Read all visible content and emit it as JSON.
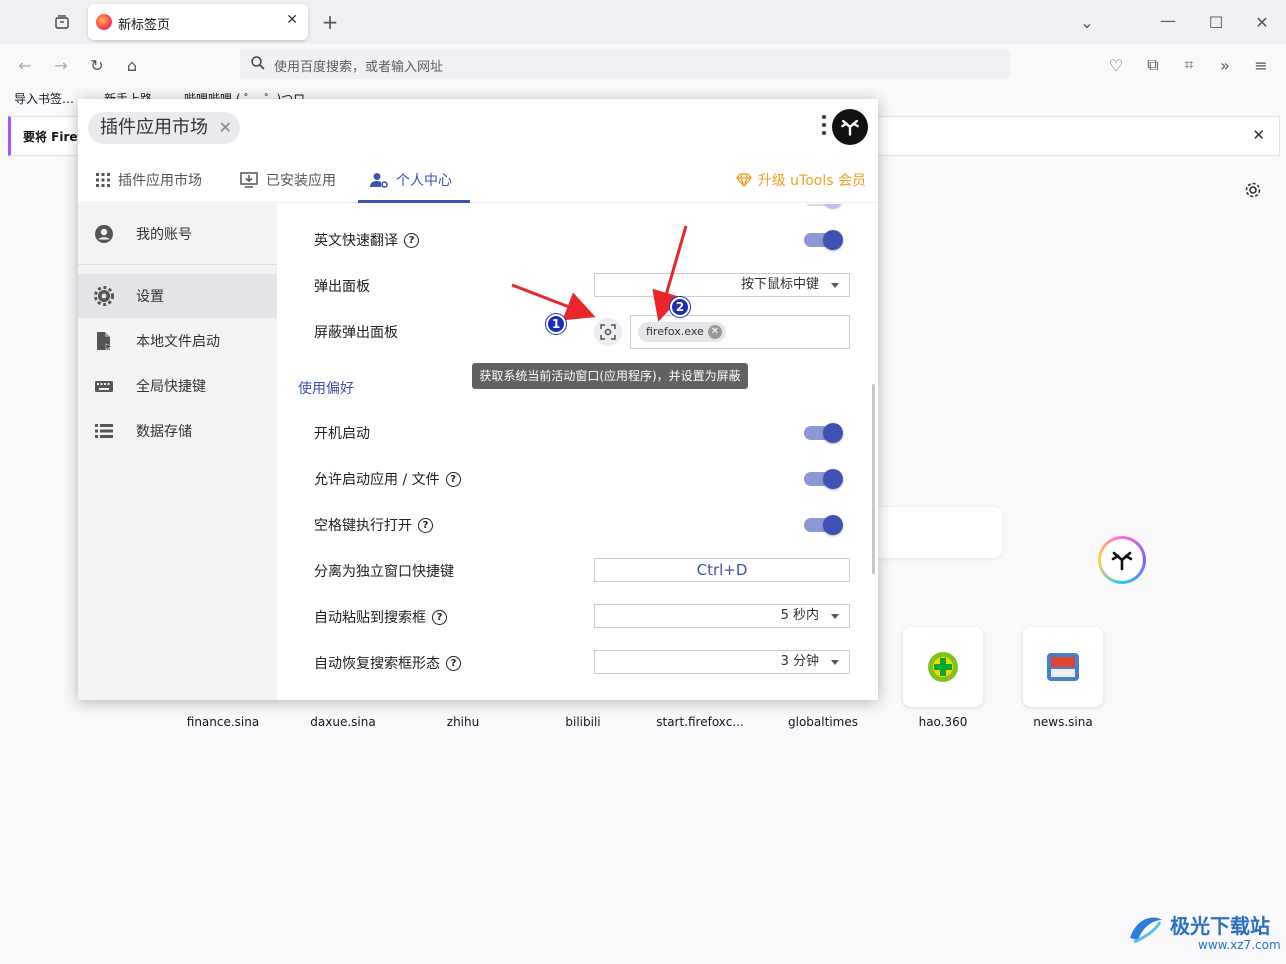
{
  "browser": {
    "tab_title": "新标签页",
    "url_placeholder": "使用百度搜索，或者输入网址",
    "bookmarks": [
      "导入书签…",
      "新手上路",
      "哔哩哔哩 ( ゜- ゜)つロ"
    ],
    "notification": "要将 Firef"
  },
  "panel": {
    "header_chip": "插件应用市场",
    "tabs": [
      "插件应用市场",
      "已安装应用",
      "个人中心"
    ],
    "active_tab": "个人中心",
    "upgrade": "升级 uTools 会员",
    "sidebar": [
      "我的账号",
      "设置",
      "本地文件启动",
      "全局快捷键",
      "数据存储"
    ],
    "active_sidebar": "设置",
    "settings": {
      "translate": "英文快速翻译",
      "popup": "弹出面板",
      "popup_value": "按下鼠标中键",
      "block": "屏蔽弹出面板",
      "block_tag": "firefox.exe",
      "section": "使用偏好",
      "autostart": "开机启动",
      "allow_launch": "允许启动应用 / 文件",
      "space_open": "空格键执行打开",
      "detach_hotkey": "分离为独立窗口快捷键",
      "detach_value": "Ctrl+D",
      "autopaste": "自动粘贴到搜索框",
      "autopaste_value": "5 秒内",
      "autorestore": "自动恢复搜索框形态",
      "autorestore_value": "3 分钟"
    },
    "tooltip": "获取系统当前活动窗口(应用程序)，并设置为屏蔽"
  },
  "annotations": [
    "1",
    "2"
  ],
  "shortcuts": [
    "finance.sina",
    "daxue.sina",
    "zhihu",
    "bilibili",
    "start.firefoxc...",
    "globaltimes",
    "hao.360",
    "news.sina"
  ],
  "watermark": {
    "name": "极光下载站",
    "url": "www.xz7.com"
  },
  "colors": {
    "accent": "#3f51b5",
    "upgrade": "#f0a020",
    "arrow": "#e8262b",
    "badge": "#1a2fb8"
  }
}
